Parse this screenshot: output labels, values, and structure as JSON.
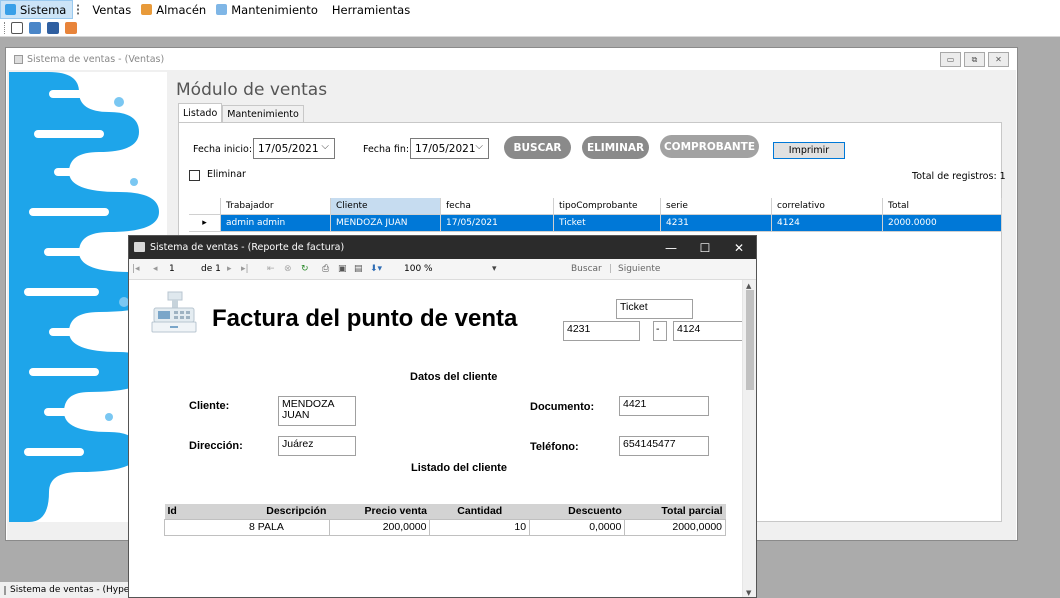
{
  "menubar": {
    "items": [
      {
        "label": "Sistema",
        "icon": "sistema-icon",
        "active": true
      },
      {
        "label": "Ventas",
        "icon": "ventas-icon"
      },
      {
        "label": "Almacén",
        "icon": "almacen-icon"
      },
      {
        "label": "Mantenimiento",
        "icon": "mantenimiento-icon"
      },
      {
        "label": "Herramientas",
        "icon": ""
      }
    ]
  },
  "toolbar": {
    "icons": [
      "new-window-icon",
      "monitor-icon",
      "save-icon",
      "boxes-icon"
    ]
  },
  "child_window": {
    "title": "Sistema de ventas - (Ventas)",
    "controls": [
      "minimize",
      "restore",
      "close"
    ]
  },
  "ventas": {
    "module_title": "Módulo de ventas",
    "tabs": [
      "Listado",
      "Mantenimiento"
    ],
    "fecha_inicio_label": "Fecha inicio:",
    "fecha_inicio_value": "17/05/2021",
    "fecha_fin_label": "Fecha fin:",
    "fecha_fin_value": "17/05/2021",
    "buttons": {
      "buscar": "BUSCAR",
      "eliminar": "ELIMINAR",
      "comprobante": "COMPROBANTE",
      "imprimir": "Imprimir"
    },
    "eliminar_checkbox_label": "Eliminar",
    "total_registros": "Total de registros: 1",
    "grid": {
      "columns": [
        "Trabajador",
        "Cliente",
        "fecha",
        "tipoComprobante",
        "serie",
        "correlativo",
        "Total"
      ],
      "rows": [
        [
          "admin admin",
          "MENDOZA JUAN",
          "17/05/2021",
          "Ticket",
          "4231",
          "4124",
          "2000.0000"
        ]
      ]
    }
  },
  "report_window": {
    "title": "Sistema de ventas - (Reporte de factura)",
    "toolbar": {
      "page": "1",
      "of_label": "de 1",
      "zoom": "100 %",
      "buscar": "Buscar",
      "siguiente": "Siguiente",
      "separator": "|"
    },
    "invoice": {
      "title": "Factura del punto de venta",
      "tipo": "Ticket",
      "serie": "4231",
      "dash": "-",
      "correlativo": "4124",
      "datos_cliente_heading": "Datos del cliente",
      "cliente_label": "Cliente:",
      "cliente_line1": "MENDOZA",
      "cliente_line2": "JUAN",
      "documento_label": "Documento:",
      "documento": "4421",
      "direccion_label": "Dirección:",
      "direccion": "Juárez",
      "telefono_label": "Teléfono:",
      "telefono": "654145477",
      "listado_heading": "Listado del cliente",
      "items_columns": [
        "Id",
        "Descripción",
        "Precio venta",
        "Cantidad",
        "Descuento",
        "Total parcial"
      ],
      "items": [
        {
          "id": "8",
          "descripcion": "PALA",
          "precio": "200,0000",
          "cantidad": "10",
          "descuento": "0,0000",
          "total": "2000,0000"
        }
      ]
    }
  },
  "taskbar": {
    "item": "Sistema de ventas - (Hyper"
  },
  "colors": {
    "selection": "#0078d7",
    "pill": "#8a8a8a",
    "decor_blue": "#1ea5ea",
    "report_titlebar": "#2b2b2b"
  }
}
